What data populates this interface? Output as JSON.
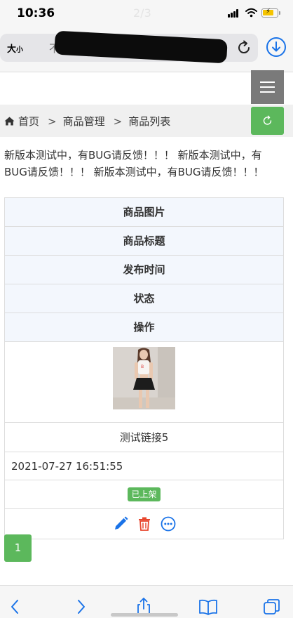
{
  "status_bar": {
    "time": "10:36",
    "page_indicator": "2/3"
  },
  "browser": {
    "text_size_label": "大",
    "text_size_small": "小",
    "url_fragment": "不",
    "accent_color": "#1a73e8"
  },
  "breadcrumb": {
    "home": "首页",
    "sep1": ">",
    "section": "商品管理",
    "sep2": ">",
    "current": "商品列表"
  },
  "notice": "新版本测试中，有BUG请反馈！！！ 新版本测试中，有BUG请反馈！！！ 新版本测试中，有BUG请反馈！！！",
  "table": {
    "headers": [
      "商品图片",
      "商品标题",
      "发布时间",
      "状态",
      "操作"
    ],
    "row": {
      "image_alt": "商品图片",
      "title": "测试链接5",
      "time": "2021-07-27 16:51:55",
      "status": "已上架"
    },
    "actions": [
      "edit-icon",
      "delete-icon",
      "more-icon"
    ]
  },
  "pagination": {
    "current": "1"
  },
  "colors": {
    "success": "#5cb85c",
    "menu_gray": "#7a7a7a",
    "header_bg": "#f3f7fd",
    "delete": "#e8472e",
    "link_blue": "#1a73e8"
  }
}
